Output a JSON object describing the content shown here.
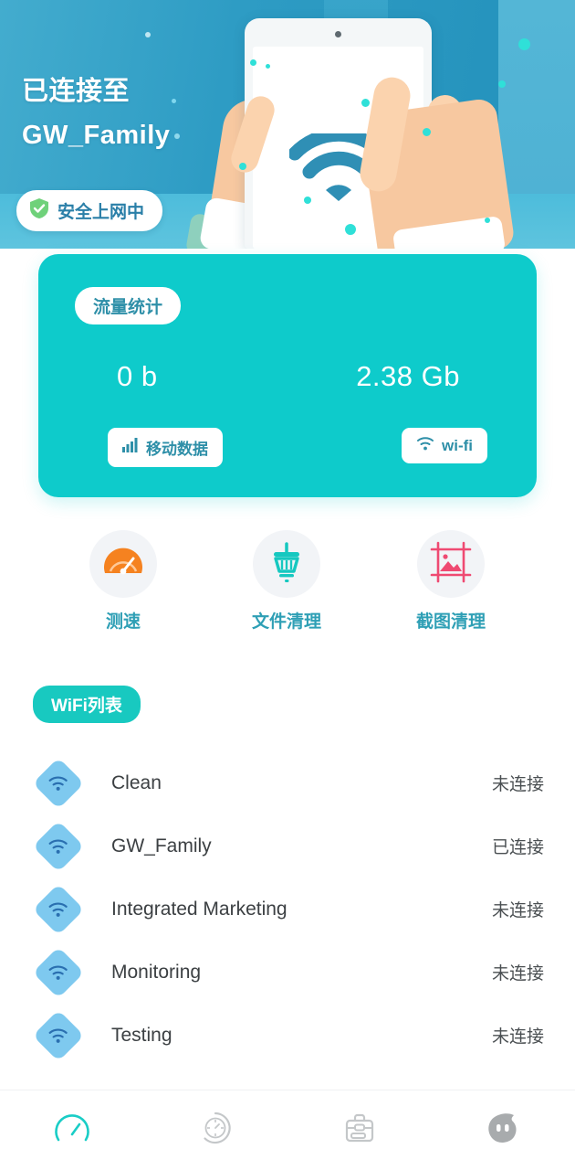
{
  "banner": {
    "title_line1": "已连接至",
    "title_line2": "GW_Family",
    "safe_badge": "安全上网中",
    "shield_icon": "shield-check-icon",
    "illustration": "tablet-wifi-hands-illustration"
  },
  "traffic_card": {
    "badge": "流量统计",
    "mobile_value": "0 b",
    "wifi_value": "2.38 Gb",
    "mobile_button": "移动数据",
    "wifi_button": "wi-fi",
    "mobile_icon": "signal-bars-icon",
    "wifi_icon": "wifi-icon",
    "bg_color": "#0ecbcb"
  },
  "actions": [
    {
      "label": "测速",
      "icon": "speedometer-icon",
      "color": "#f58220"
    },
    {
      "label": "文件清理",
      "icon": "broom-icon",
      "color": "#16c8c0"
    },
    {
      "label": "截图清理",
      "icon": "image-frame-icon",
      "color": "#ef4a72"
    }
  ],
  "wifi_section": {
    "title": "WiFi列表",
    "items": [
      {
        "name": "Clean",
        "status": "未连接"
      },
      {
        "name": "GW_Family",
        "status": "已连接"
      },
      {
        "name": "Integrated Marketing",
        "status": "未连接"
      },
      {
        "name": "Monitoring",
        "status": "未连接"
      },
      {
        "name": "Testing",
        "status": "未连接"
      }
    ]
  },
  "bottom_nav": [
    {
      "icon": "speedometer-icon",
      "active": true,
      "color": "#19cdc6"
    },
    {
      "icon": "compass-icon",
      "active": false,
      "color": "#c4c7c9"
    },
    {
      "icon": "toolbox-icon",
      "active": false,
      "color": "#c4c7c9"
    },
    {
      "icon": "mascot-face-icon",
      "active": false,
      "color": "#a8abad"
    }
  ]
}
